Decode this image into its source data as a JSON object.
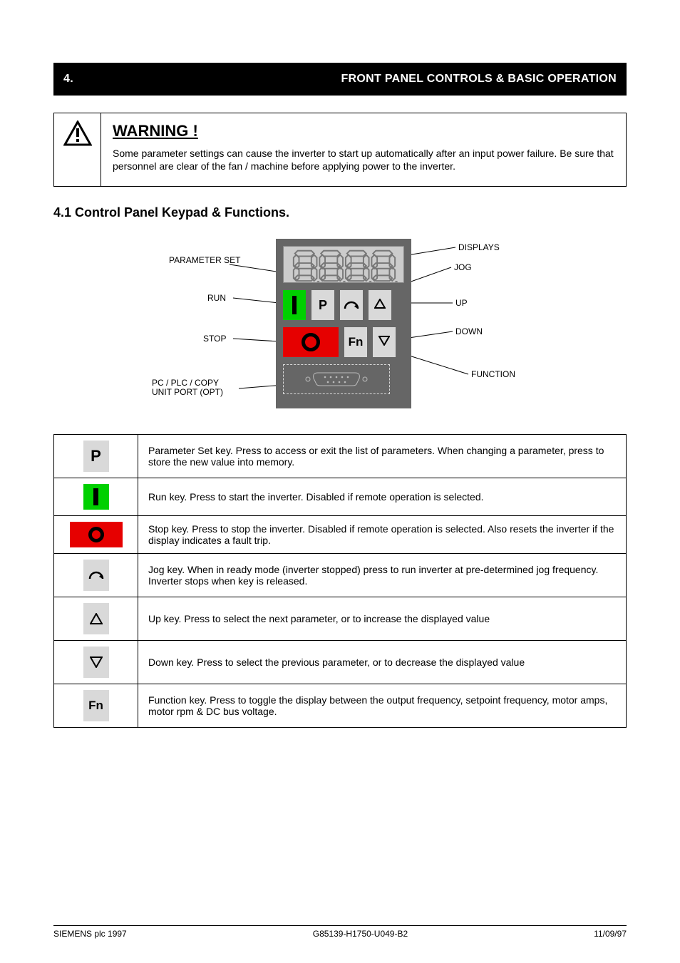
{
  "section": {
    "number_label": "4.",
    "title": "FRONT PANEL CONTROLS & BASIC OPERATION"
  },
  "warning": {
    "title": "WARNING !",
    "body": "Some parameter settings can cause the inverter to start up automatically after an input power failure. Be sure that personnel are clear of the fan / machine before applying power to the inverter."
  },
  "subhead": "4.1  Control Panel Keypad & Functions.",
  "diagram_labels": {
    "left_top": "PARAMETER\nSET",
    "left_mid": "RUN",
    "left_low": "STOP",
    "left_bottom": "PC / PLC / COPY\nUNIT PORT (OPT)",
    "right_top": "DISPLAYS",
    "right_mid": "JOG",
    "right_low": "UP",
    "right_lower": "DOWN",
    "right_bottom": "FUNCTION"
  },
  "panel": {
    "p_label": "P",
    "fn_label": "Fn",
    "display_placeholder": "8.8.8.8."
  },
  "keytable": {
    "rows": [
      {
        "icon": "p",
        "text": "Parameter Set key. Press to access or exit the list of parameters. When changing a parameter, press to store the new value into memory."
      },
      {
        "icon": "run",
        "text": "Run key. Press to start the inverter. Disabled if remote operation is selected."
      },
      {
        "icon": "stop",
        "text": "Stop key. Press to stop the inverter. Disabled if remote operation is selected.  Also resets the inverter if the display indicates a fault trip."
      },
      {
        "icon": "jog",
        "text": "Jog key. When in ready mode (inverter stopped) press to run inverter at pre-determined jog frequency. Inverter stops when key is released."
      },
      {
        "icon": "up",
        "text": "Up key. Press to select the next parameter, or to increase the displayed value"
      },
      {
        "icon": "down",
        "text": "Down key. Press to select the previous parameter, or to decrease the displayed value"
      },
      {
        "icon": "fn",
        "text": "Function key. Press to toggle the display between the output frequency, setpoint frequency, motor amps, motor rpm & DC bus voltage."
      }
    ]
  },
  "footer": {
    "left": "SIEMENS plc 1997",
    "center": "G85139-H1750-U049-B2",
    "right": "11/09/97"
  }
}
